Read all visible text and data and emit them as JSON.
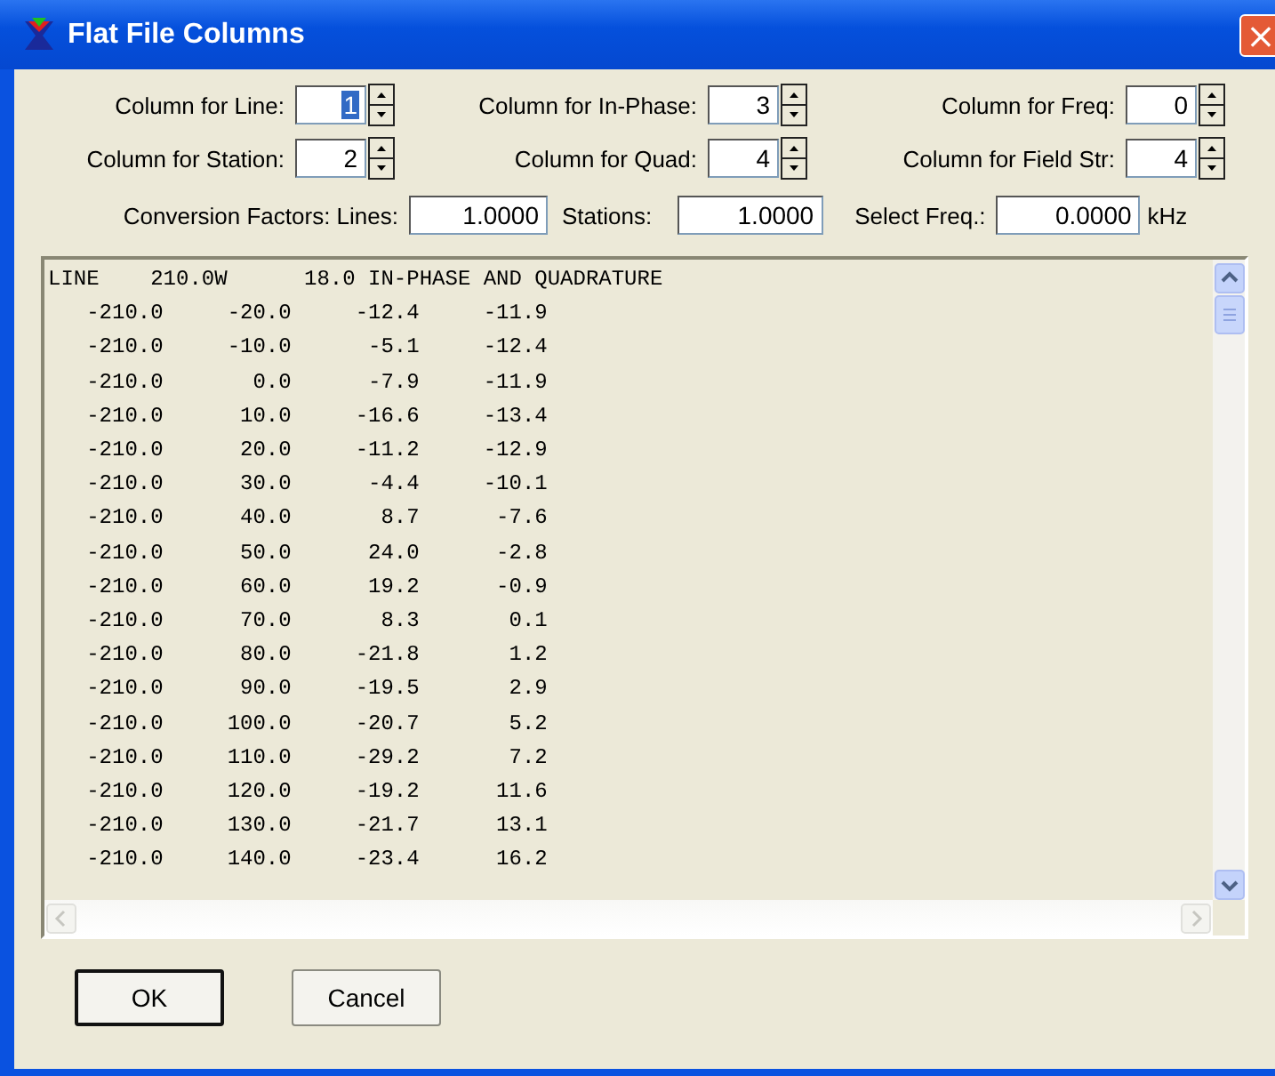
{
  "window": {
    "title": "Flat File Columns",
    "close": "×"
  },
  "columns": [
    {
      "label": "Column for Line:",
      "value": "1",
      "selected": true
    },
    {
      "label": "Column for In-Phase:",
      "value": "3",
      "selected": false
    },
    {
      "label": "Column for Freq:",
      "value": "0",
      "selected": false
    },
    {
      "label": "Column for Station:",
      "value": "2",
      "selected": false
    },
    {
      "label": "Column for Quad:",
      "value": "4",
      "selected": false
    },
    {
      "label": "Column for Field Str:",
      "value": "4",
      "selected": false
    }
  ],
  "conversion": [
    {
      "label": "Conversion Factors: Lines:",
      "value": "1.0000"
    },
    {
      "label": "Stations:",
      "value": "1.0000"
    },
    {
      "label": "Select Freq.:",
      "value": "0.0000",
      "unit": "kHz"
    }
  ],
  "text_lines": [
    "LINE    210.0W      18.0 IN-PHASE AND QUADRATURE",
    "   -210.0     -20.0     -12.4     -11.9",
    "   -210.0     -10.0      -5.1     -12.4",
    "   -210.0       0.0      -7.9     -11.9",
    "   -210.0      10.0     -16.6     -13.4",
    "   -210.0      20.0     -11.2     -12.9",
    "   -210.0      30.0      -4.4     -10.1",
    "   -210.0      40.0       8.7      -7.6",
    "   -210.0      50.0      24.0      -2.8",
    "   -210.0      60.0      19.2      -0.9",
    "   -210.0      70.0       8.3       0.1",
    "   -210.0      80.0     -21.8       1.2",
    "   -210.0      90.0     -19.5       2.9",
    "   -210.0     100.0     -20.7       5.2",
    "   -210.0     110.0     -29.2       7.2",
    "   -210.0     120.0     -19.2      11.6",
    "   -210.0     130.0     -21.7      13.1",
    "   -210.0     140.0     -23.4      16.2"
  ],
  "buttons": [
    {
      "label": "OK",
      "kind": "default"
    },
    {
      "label": "Cancel",
      "kind": "normal"
    }
  ]
}
